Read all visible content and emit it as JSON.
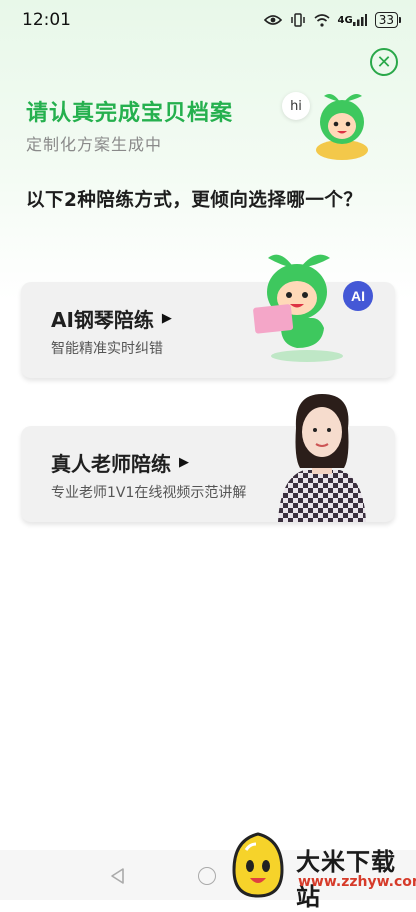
{
  "status_bar": {
    "time": "12:01",
    "network": "4G",
    "battery": "33"
  },
  "header": {
    "title": "请认真完成宝贝档案",
    "subtitle": "定制化方案生成中",
    "greeting": "hi",
    "question": "以下2种陪练方式，更倾向选择哪一个？"
  },
  "options": [
    {
      "title": "AI钢琴陪练",
      "desc": "智能精准实时纠错",
      "badge": "AI"
    },
    {
      "title": "真人老师陪练",
      "desc": "专业老师1V1在线视频示范讲解"
    }
  ],
  "watermark": {
    "name": "大米下载站",
    "url": "www.zzhyw.com"
  },
  "colors": {
    "accent": "#25b04e",
    "card_bg": "#f1f1f1"
  }
}
